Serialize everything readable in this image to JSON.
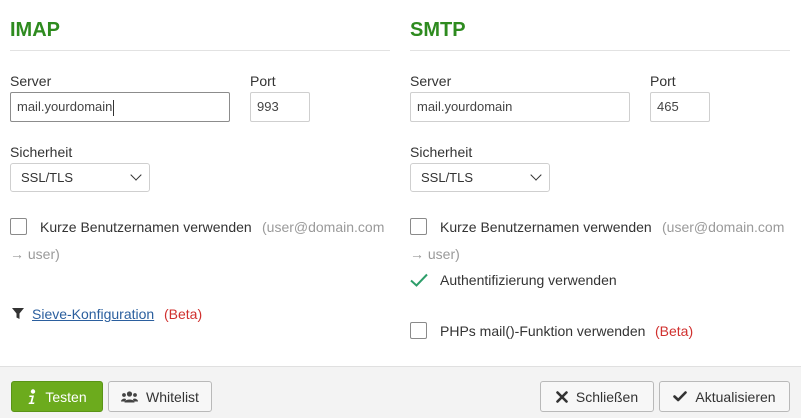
{
  "imap": {
    "title": "IMAP",
    "server_label": "Server",
    "server_value": "mail.yourdomain",
    "port_label": "Port",
    "port_value": "993",
    "security_label": "Sicherheit",
    "security_value": "SSL/TLS",
    "short_usernames_label": "Kurze Benutzernamen verwenden",
    "short_usernames_hint_1": "(user@domain.com",
    "short_usernames_hint_2": "→ user)",
    "short_usernames_checked": false,
    "sieve_link": "Sieve-Konfiguration",
    "sieve_beta": "(Beta)"
  },
  "smtp": {
    "title": "SMTP",
    "server_label": "Server",
    "server_value": "mail.yourdomain",
    "port_label": "Port",
    "port_value": "465",
    "security_label": "Sicherheit",
    "security_value": "SSL/TLS",
    "short_usernames_label": "Kurze Benutzernamen verwenden",
    "short_usernames_hint_1": "(user@domain.com",
    "short_usernames_hint_2": "→ user)",
    "short_usernames_checked": false,
    "auth_label": "Authentifizierung verwenden",
    "auth_checked": true,
    "phpmail_label": "PHPs mail()-Funktion verwenden",
    "phpmail_beta": "(Beta)",
    "phpmail_checked": false
  },
  "footer": {
    "test_label": "Testen",
    "whitelist_label": "Whitelist",
    "close_label": "Schließen",
    "update_label": "Aktualisieren"
  },
  "colors": {
    "title_green": "#2e8b1f",
    "primary_button": "#6cab1d",
    "beta_red": "#d0302e",
    "link_blue": "#2b5f9e",
    "check_green": "#2e9e6a"
  }
}
